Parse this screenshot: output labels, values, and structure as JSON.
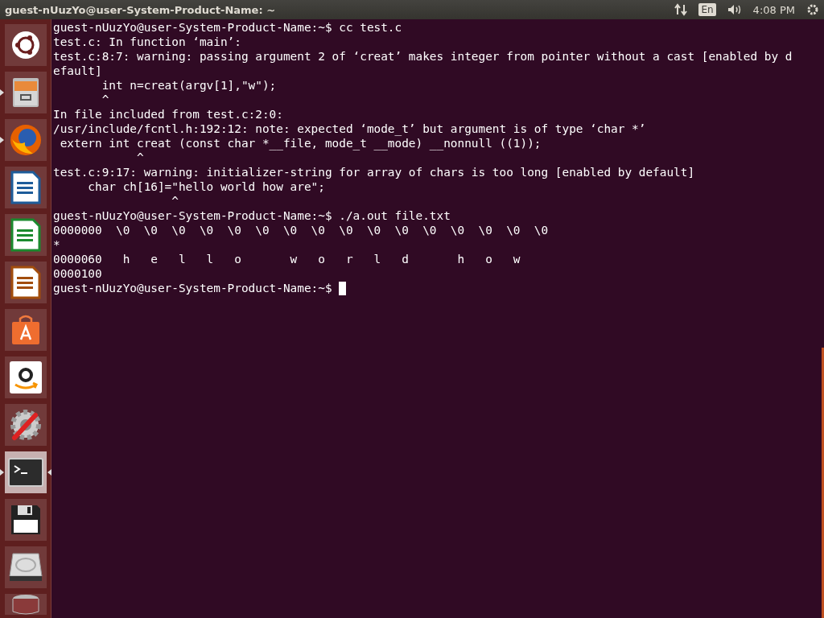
{
  "top_bar": {
    "title": "guest-nUuzYo@user-System-Product-Name: ~",
    "keyboard": "En",
    "time": "4:08 PM"
  },
  "launcher": [
    {
      "kind": "dash",
      "running": false,
      "focused": false
    },
    {
      "kind": "files",
      "running": true,
      "focused": false
    },
    {
      "kind": "browser",
      "running": true,
      "focused": false
    },
    {
      "kind": "writer",
      "running": false,
      "focused": false
    },
    {
      "kind": "calc",
      "running": false,
      "focused": false
    },
    {
      "kind": "impress",
      "running": false,
      "focused": false
    },
    {
      "kind": "store",
      "running": false,
      "focused": false
    },
    {
      "kind": "amazon",
      "running": false,
      "focused": false
    },
    {
      "kind": "settings",
      "running": false,
      "focused": false
    },
    {
      "kind": "terminal",
      "running": true,
      "focused": true
    },
    {
      "kind": "floppy",
      "running": false,
      "focused": false
    },
    {
      "kind": "drive",
      "running": false,
      "focused": false
    },
    {
      "kind": "trash",
      "running": false,
      "focused": false
    }
  ],
  "terminal": {
    "lines": [
      "guest-nUuzYo@user-System-Product-Name:~$ cc test.c",
      "test.c: In function ‘main’:",
      "test.c:8:7: warning: passing argument 2 of ‘creat’ makes integer from pointer without a cast [enabled by d",
      "efault]",
      "       int n=creat(argv[1],\"w\");",
      "       ^",
      "In file included from test.c:2:0:",
      "/usr/include/fcntl.h:192:12: note: expected ‘mode_t’ but argument is of type ‘char *’",
      " extern int creat (const char *__file, mode_t __mode) __nonnull ((1));",
      "            ^",
      "test.c:9:17: warning: initializer-string for array of chars is too long [enabled by default]",
      "     char ch[16]=\"hello world how are\";",
      "                 ^",
      "guest-nUuzYo@user-System-Product-Name:~$ ./a.out file.txt",
      "0000000  \\0  \\0  \\0  \\0  \\0  \\0  \\0  \\0  \\0  \\0  \\0  \\0  \\0  \\0  \\0  \\0",
      "*",
      "0000060   h   e   l   l   o       w   o   r   l   d       h   o   w",
      "0000100",
      "guest-nUuzYo@user-System-Product-Name:~$ "
    ],
    "cursor": true
  }
}
